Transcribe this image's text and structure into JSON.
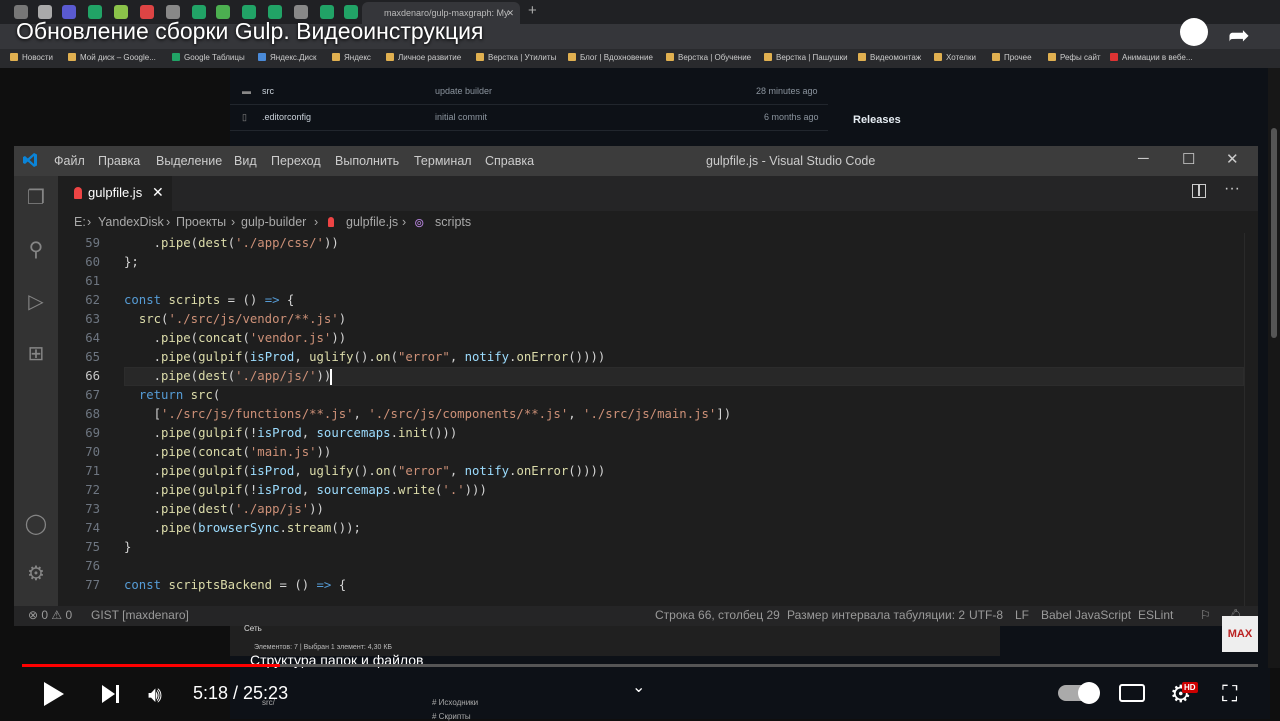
{
  "browser": {
    "active_tab_title": "maxdenaro/gulp-maxgraph: My",
    "bookmarks": [
      "Новости",
      "Мой диск – Google...",
      "Google Таблицы",
      "Яндекс.Диск",
      "Яндекс",
      "Личное развитие",
      "Верстка | Утилиты",
      "Блог | Вдохновение",
      "Верстка | Обучение",
      "Верстка | Пашушки",
      "Видеомонтаж",
      "Хотелки",
      "Прочее",
      "Рефы сайт",
      "Анимации в вебе..."
    ]
  },
  "video": {
    "title": "Обновление сборки Gulp. Видеоинструкция",
    "current_time": "5:18",
    "duration": "25:23",
    "time_display": "5:18 / 25:23",
    "progress_fraction": 0.209,
    "subtitle": "Структура папок и файлов",
    "hd_badge": "HD",
    "channel_logo": "MAX"
  },
  "github": {
    "rows": [
      {
        "name": "src",
        "message": "update builder",
        "time": "28 minutes ago"
      },
      {
        "name": ".editorconfig",
        "message": "initial commit",
        "time": "6 months ago"
      }
    ],
    "releases": "Releases"
  },
  "vscode": {
    "menu": [
      "Файл",
      "Правка",
      "Выделение",
      "Вид",
      "Переход",
      "Выполнить",
      "Терминал",
      "Справка"
    ],
    "window_title": "gulpfile.js - Visual Studio Code",
    "tab": "gulpfile.js",
    "breadcrumb": [
      "E:",
      "YandexDisk",
      "Проекты",
      "gulp-builder",
      "gulpfile.js",
      "scripts"
    ],
    "line_numbers": [
      "59",
      "60",
      "61",
      "62",
      "63",
      "64",
      "65",
      "66",
      "67",
      "68",
      "69",
      "70",
      "71",
      "72",
      "73",
      "74",
      "75",
      "76",
      "77"
    ],
    "current_line": "66",
    "status": {
      "problems": "⊗ 0 ⚠ 0",
      "gist": "GIST [maxdenaro]",
      "position": "Строка 66, столбец 29",
      "tab_size": "Размер интервала табуляции: 2",
      "encoding": "UTF-8",
      "eol": "LF",
      "language": "Babel JavaScript",
      "linter": "ESLint"
    }
  },
  "explorer": {
    "net_item": "Сеть",
    "status": "Элементов: 7  |  Выбран 1 элемент: 4,30 КБ",
    "tree_item": "src/",
    "comments": [
      "# Исходники",
      "# Скрипты"
    ]
  }
}
